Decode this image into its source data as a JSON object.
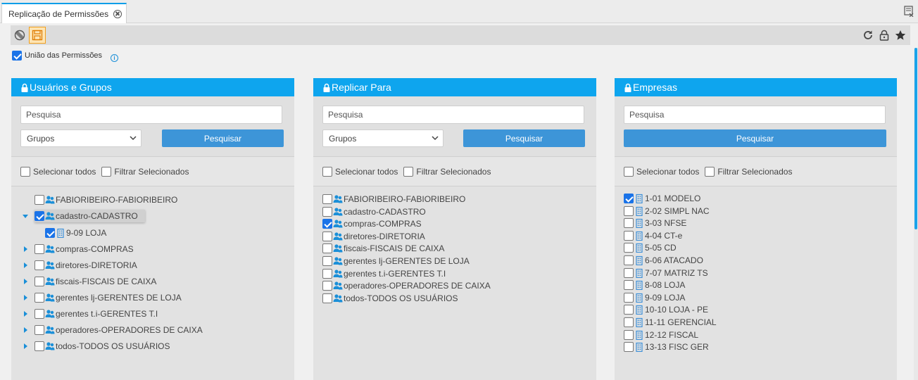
{
  "colors": {
    "accent": "#0ea5ee",
    "button": "#3d95d8",
    "check": "#1a73e8"
  },
  "tab": {
    "title": "Replicação de Permissões"
  },
  "toolbar": {
    "left_icons": [
      "cancel-icon",
      "save-icon"
    ],
    "right_icons": [
      "refresh-icon",
      "lock-icon",
      "star-icon"
    ]
  },
  "options": {
    "union_label": "União das Permissões",
    "union_checked": true
  },
  "panels": [
    {
      "title": "Usuários e Grupos",
      "search_placeholder": "Pesquisa",
      "select_value": "Grupos",
      "search_button": "Pesquisar",
      "select_all": "Selecionar todos",
      "filter_selected": "Filtrar Selecionados",
      "items": [
        {
          "label": "FABIORIBEIRO-FABIORIBEIRO",
          "checked": false,
          "expander": "none"
        },
        {
          "label": "cadastro-CADASTRO",
          "checked": true,
          "expander": "expanded"
        },
        {
          "label": "9-09 LOJA",
          "checked": true,
          "expander": "none",
          "child": true
        },
        {
          "label": "compras-COMPRAS",
          "checked": false,
          "expander": "collapsed"
        },
        {
          "label": "diretores-DIRETORIA",
          "checked": false,
          "expander": "collapsed"
        },
        {
          "label": "fiscais-FISCAIS DE CAIXA",
          "checked": false,
          "expander": "collapsed"
        },
        {
          "label": "gerentes lj-GERENTES DE LOJA",
          "checked": false,
          "expander": "collapsed"
        },
        {
          "label": "gerentes t.i-GERENTES T.I",
          "checked": false,
          "expander": "collapsed"
        },
        {
          "label": "operadores-OPERADORES DE CAIXA",
          "checked": false,
          "expander": "collapsed"
        },
        {
          "label": "todos-TODOS OS USUÁRIOS",
          "checked": false,
          "expander": "collapsed"
        }
      ]
    },
    {
      "title": "Replicar Para",
      "search_placeholder": "Pesquisa",
      "select_value": "Grupos",
      "search_button": "Pesquisar",
      "select_all": "Selecionar todos",
      "filter_selected": "Filtrar Selecionados",
      "items": [
        {
          "label": "FABIORIBEIRO-FABIORIBEIRO",
          "checked": false
        },
        {
          "label": "cadastro-CADASTRO",
          "checked": false
        },
        {
          "label": "compras-COMPRAS",
          "checked": true
        },
        {
          "label": "diretores-DIRETORIA",
          "checked": false
        },
        {
          "label": "fiscais-FISCAIS DE CAIXA",
          "checked": false
        },
        {
          "label": "gerentes lj-GERENTES DE LOJA",
          "checked": false
        },
        {
          "label": "gerentes t.i-GERENTES T.I",
          "checked": false
        },
        {
          "label": "operadores-OPERADORES DE CAIXA",
          "checked": false
        },
        {
          "label": "todos-TODOS OS USUÁRIOS",
          "checked": false
        }
      ]
    },
    {
      "title": "Empresas",
      "search_placeholder": "Pesquisa",
      "search_button": "Pesquisar",
      "select_all": "Selecionar todos",
      "filter_selected": "Filtrar Selecionados",
      "items": [
        {
          "label": "1-01 MODELO",
          "checked": true
        },
        {
          "label": "2-02 SIMPL NAC",
          "checked": false
        },
        {
          "label": "3-03 NFSE",
          "checked": false
        },
        {
          "label": "4-04 CT-e",
          "checked": false
        },
        {
          "label": "5-05 CD",
          "checked": false
        },
        {
          "label": "6-06 ATACADO",
          "checked": false
        },
        {
          "label": "7-07 MATRIZ TS",
          "checked": false
        },
        {
          "label": "8-08 LOJA",
          "checked": false
        },
        {
          "label": "9-09 LOJA",
          "checked": false
        },
        {
          "label": "10-10 LOJA - PE",
          "checked": false
        },
        {
          "label": "11-11 GERENCIAL",
          "checked": false
        },
        {
          "label": "12-12 FISCAL",
          "checked": false
        },
        {
          "label": "13-13 FISC GER",
          "checked": false
        }
      ]
    }
  ]
}
